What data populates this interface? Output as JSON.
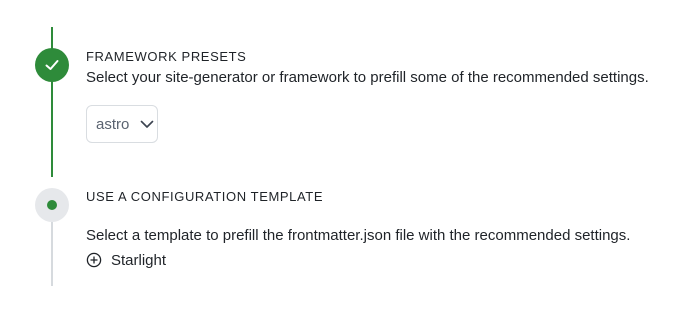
{
  "steps": [
    {
      "status": "complete",
      "icon": "check-icon",
      "title": "FRAMEWORK PRESETS",
      "description": "Select your site-generator or framework to prefill some of the recommended settings.",
      "select": {
        "value": "astro",
        "icon": "chevron-down-icon"
      }
    },
    {
      "status": "active",
      "icon": "dot-icon",
      "title": "USE A CONFIGURATION TEMPLATE",
      "description": "Select a template to prefill the frontmatter.json file with the recommended settings.",
      "templates": [
        {
          "label": "Starlight",
          "icon": "plus-circle-icon"
        }
      ]
    }
  ],
  "colors": {
    "accent": "#2e8b3a",
    "pending_rail": "#d6dade",
    "active_node_bg": "#e6e8eb",
    "text": "#1f2328",
    "muted_text": "#5a6370",
    "border": "#d9dde1"
  }
}
